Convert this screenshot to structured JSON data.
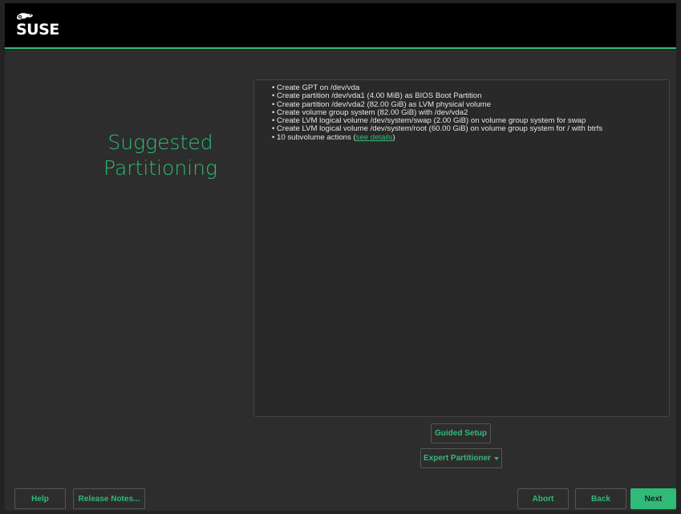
{
  "header": {
    "logo_text": "SUSE"
  },
  "page": {
    "title_line1": "Suggested",
    "title_line2": "Partitioning"
  },
  "proposal": {
    "items": [
      "Create GPT on /dev/vda",
      "Create partition /dev/vda1 (4.00 MiB) as BIOS Boot Partition",
      "Create partition /dev/vda2 (82.00 GiB) as LVM physical volume",
      "Create volume group system (82.00 GiB) with /dev/vda2",
      "Create LVM logical volume /dev/system/swap (2.00 GiB) on volume group system for swap",
      "Create LVM logical volume /dev/system/root (60.00 GiB) on volume group system for / with btrfs"
    ],
    "subvolume_prefix": "10 subvolume actions (",
    "subvolume_link": "see details",
    "subvolume_suffix": ")"
  },
  "actions": {
    "guided_setup": "Guided Setup",
    "expert_partitioner": "Expert Partitioner"
  },
  "footer": {
    "help": "Help",
    "release_notes": "Release Notes...",
    "abort": "Abort",
    "back": "Back",
    "next": "Next"
  },
  "colors": {
    "accent": "#30ba78",
    "background": "#2d2d2d",
    "header": "#000000"
  }
}
